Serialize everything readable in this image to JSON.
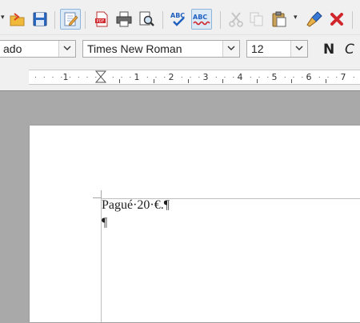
{
  "toolbar": {
    "buttons": [
      {
        "name": "open-dropdown-arrow-icon"
      },
      {
        "name": "open-icon"
      },
      {
        "name": "save-icon"
      },
      {
        "name": "edit-file-icon",
        "active": true
      },
      {
        "name": "export-pdf-icon"
      },
      {
        "name": "print-icon"
      },
      {
        "name": "print-preview-icon"
      },
      {
        "name": "spelling-icon"
      },
      {
        "name": "auto-spellcheck-icon",
        "active": true
      },
      {
        "name": "cut-icon",
        "disabled": true
      },
      {
        "name": "copy-icon",
        "disabled": true
      },
      {
        "name": "paste-icon"
      },
      {
        "name": "clone-formatting-icon"
      },
      {
        "name": "clear-formatting-icon"
      }
    ],
    "spelling_text": "ABC",
    "accent_color": "#1f5fbf",
    "error_color": "#d0262c"
  },
  "formatting": {
    "paragraph_style": "ado",
    "font_name": "Times New Roman",
    "font_size": "12",
    "bold_label": "N",
    "italic_label": "C"
  },
  "ruler": {
    "numbers": [
      "1",
      "1",
      "2",
      "3",
      "4",
      "5",
      "6",
      "7"
    ]
  },
  "document": {
    "paragraphs": [
      "Pagué·20·€.¶",
      "¶"
    ]
  }
}
